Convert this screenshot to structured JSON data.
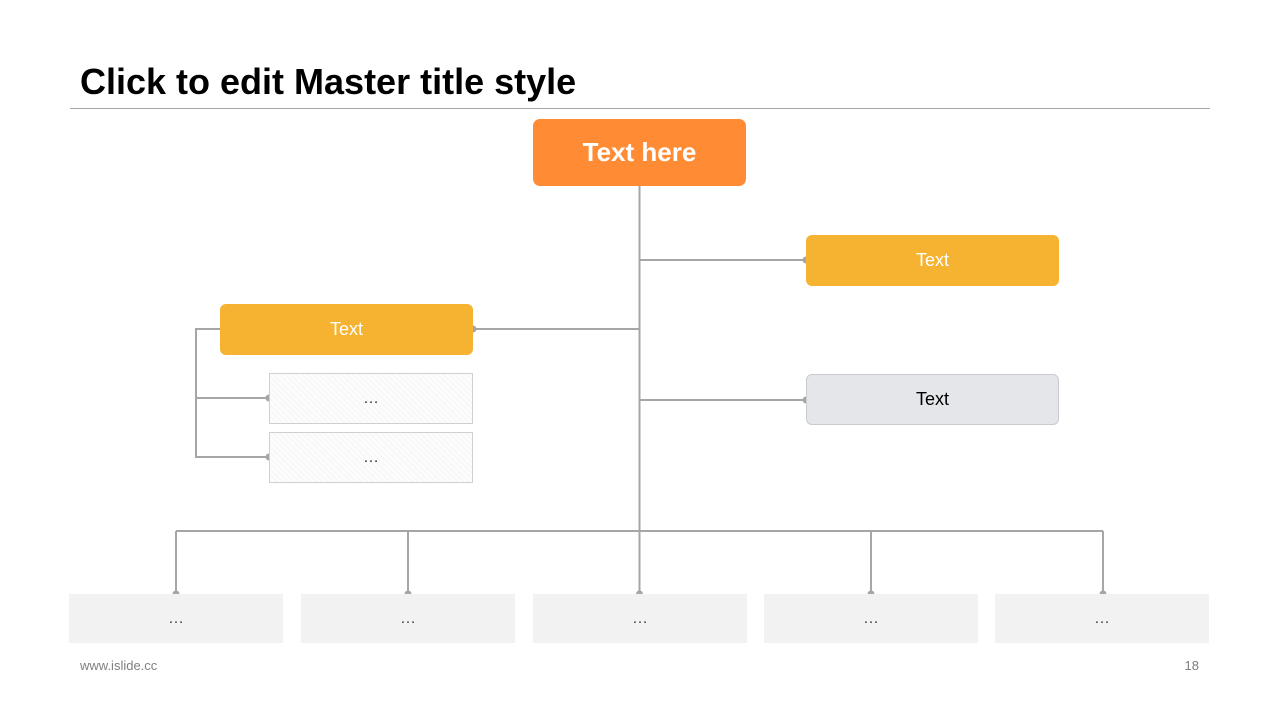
{
  "slide": {
    "title": "Click to edit Master title style",
    "footer_url": "www.islide.cc",
    "page_number": "18"
  },
  "colors": {
    "root_fill": "#ff8c35",
    "branch_fill": "#f6b331",
    "gray_fill": "#e5e6ea",
    "leaf_fill": "#f2f2f2",
    "connector": "#a6a6a6"
  },
  "diagram": {
    "root": {
      "label": "Text here"
    },
    "right_branches": [
      {
        "label": "Text",
        "style": "accent"
      },
      {
        "label": "Text",
        "style": "gray"
      }
    ],
    "left_branch": {
      "label": "Text",
      "children": [
        {
          "label": "…"
        },
        {
          "label": "…"
        }
      ]
    },
    "bottom_items": [
      {
        "label": "…"
      },
      {
        "label": "…"
      },
      {
        "label": "…"
      },
      {
        "label": "…"
      },
      {
        "label": "…"
      }
    ]
  }
}
